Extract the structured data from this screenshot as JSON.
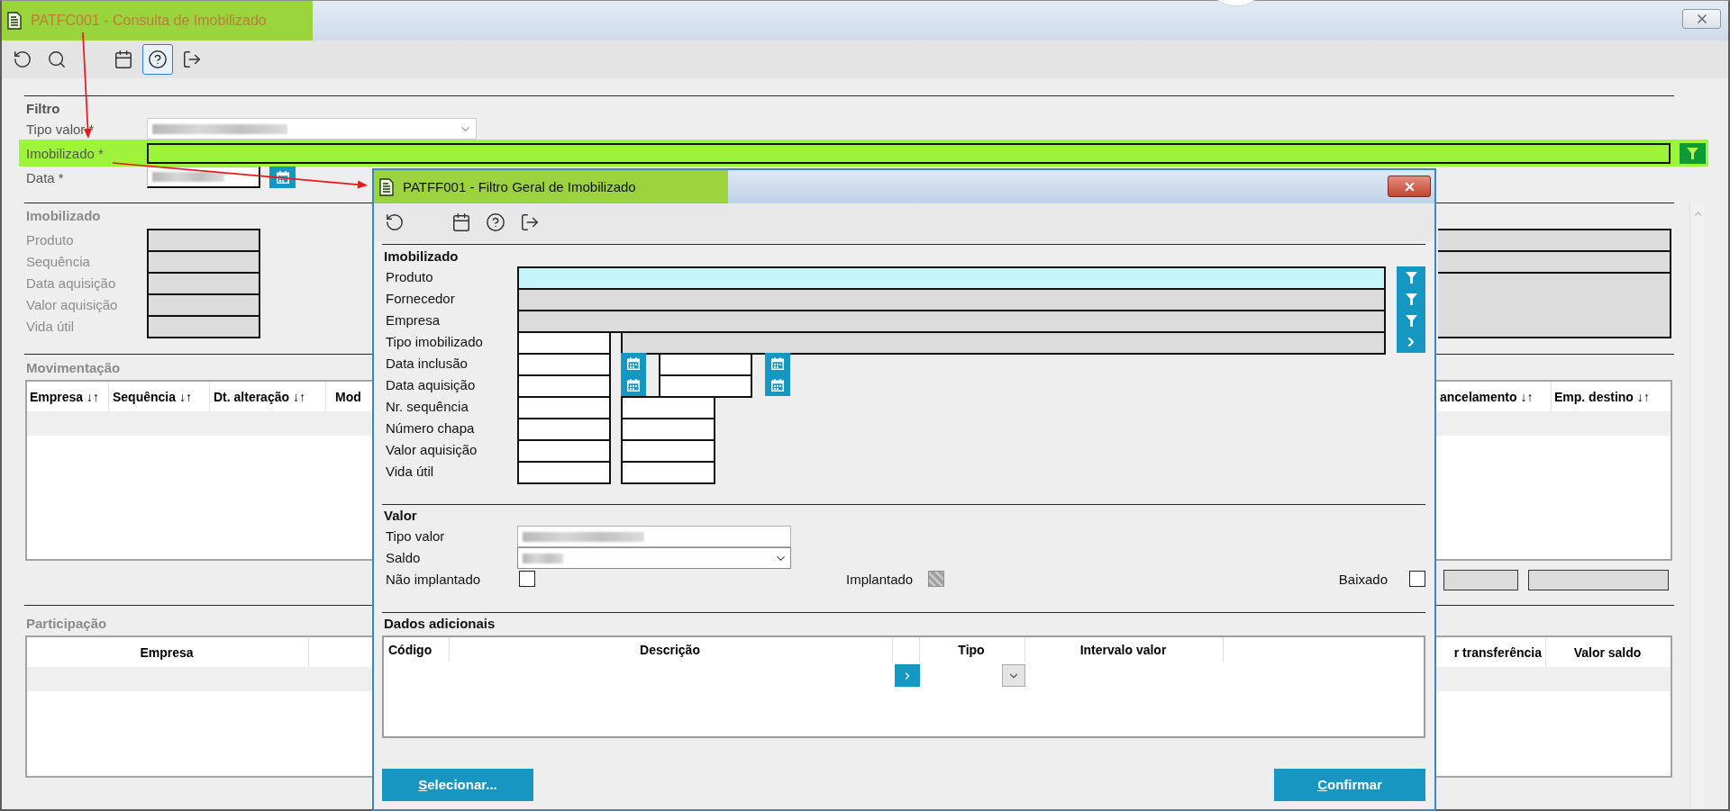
{
  "main_window": {
    "title": "PATFC001 - Consulta de Imobilizado",
    "title_highlighted": true,
    "toolbar": {
      "groups": [
        {
          "items": [
            {
              "kind": "refresh",
              "selected": false
            },
            {
              "kind": "search",
              "selected": false
            }
          ]
        },
        {
          "items": [
            {
              "kind": "calendar",
              "selected": false
            },
            {
              "kind": "help",
              "selected": true
            },
            {
              "kind": "exit",
              "selected": false
            }
          ]
        }
      ]
    },
    "filter": {
      "title": "Filtro",
      "fields": [
        {
          "kind": "select",
          "label": "Tipo valor *",
          "highlighted": false,
          "redacted": true
        },
        {
          "kind": "lookup",
          "label": "Imobilizado *",
          "highlighted": true,
          "redacted": false
        },
        {
          "kind": "date",
          "label": "Data *",
          "highlighted": false,
          "redacted": true
        }
      ]
    },
    "imobilizado": {
      "title": "Imobilizado",
      "fields": [
        {
          "label": "Produto"
        },
        {
          "label": "Sequência"
        },
        {
          "label": "Data aquisição"
        },
        {
          "label": "Valor aquisição"
        },
        {
          "label": "Vida útil"
        }
      ]
    },
    "movimentacao": {
      "title": "Movimentação",
      "columns": [
        {
          "label": "Empresa ↓↑"
        },
        {
          "label": "Sequência ↓↑"
        },
        {
          "label": "Dt. alteração ↓↑"
        },
        {
          "label": "Mod"
        },
        {
          "label": "ancelamento ↓↑"
        },
        {
          "label": "Emp. destino ↓↑"
        }
      ]
    },
    "participacao": {
      "title": "Participação",
      "columns": [
        {
          "label": "Empresa"
        },
        {
          "label": "r transferência"
        },
        {
          "label": "Valor saldo"
        }
      ]
    }
  },
  "dialog": {
    "title": "PATFF001 - Filtro Geral de Imobilizado",
    "title_highlighted": true,
    "toolbar": {
      "groups": [
        {
          "items": [
            {
              "kind": "refresh",
              "selected": false
            }
          ]
        },
        {
          "items": [
            {
              "kind": "calendar",
              "selected": false
            },
            {
              "kind": "help",
              "selected": false
            },
            {
              "kind": "exit",
              "selected": false
            }
          ]
        }
      ]
    },
    "imobilizado": {
      "title": "Imobilizado",
      "rows": [
        {
          "kind": "lookup",
          "label": "Produto",
          "focused": true
        },
        {
          "kind": "lookup",
          "label": "Fornecedor",
          "focused": false
        },
        {
          "kind": "lookup",
          "label": "Empresa",
          "focused": false
        },
        {
          "kind": "type_lookup",
          "label": "Tipo imobilizado"
        },
        {
          "kind": "date_range",
          "label": "Data inclusão"
        },
        {
          "kind": "date_range",
          "label": "Data aquisição"
        },
        {
          "kind": "range",
          "label": "Nr. sequência"
        },
        {
          "kind": "range",
          "label": "Número chapa"
        },
        {
          "kind": "range",
          "label": "Valor aquisição"
        },
        {
          "kind": "range",
          "label": "Vida útil"
        }
      ]
    },
    "valor": {
      "title": "Valor",
      "fields": [
        {
          "kind": "text",
          "label": "Tipo valor",
          "redacted": true
        },
        {
          "kind": "select",
          "label": "Saldo",
          "redacted": true
        }
      ],
      "checkboxes": [
        {
          "label": "Não implantado",
          "checked": false,
          "disabled": false
        },
        {
          "label": "Implantado",
          "checked": false,
          "disabled": true
        },
        {
          "label": "Baixado",
          "checked": false,
          "disabled": false
        }
      ]
    },
    "dados_adicionais": {
      "title": "Dados adicionais",
      "columns": [
        {
          "kind": "text",
          "label": "Código"
        },
        {
          "kind": "text",
          "label": "Descrição"
        },
        {
          "kind": "button"
        },
        {
          "kind": "select",
          "label": "Tipo"
        },
        {
          "kind": "text",
          "label": "Intervalo valor"
        }
      ]
    },
    "buttons": [
      {
        "label": "Selecionar..."
      },
      {
        "label": "Confirmar"
      }
    ]
  }
}
